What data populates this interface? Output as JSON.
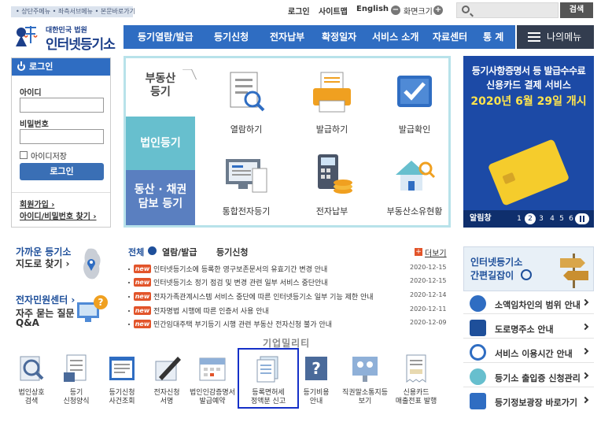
{
  "skip_links": "• 상단주메뉴 • 좌측서브메뉴 • 본문바로가기",
  "top_links": {
    "login": "로그인",
    "sitemap": "사이트맵",
    "english": "English",
    "zoom_label": "화면크기",
    "zoom_minus": "−",
    "zoom_plus": "+"
  },
  "search": {
    "placeholder": "",
    "button": "검색"
  },
  "logo": {
    "small": "대한민국 법원",
    "big": "인터넷등기소"
  },
  "gnb": [
    "등기열람/발급",
    "등기신청",
    "전자납부",
    "확정일자",
    "서비스 소개",
    "자료센터",
    "통 계"
  ],
  "my_menu": "나의메뉴",
  "login_box": {
    "title": "로그인",
    "id_label": "아이디",
    "pw_label": "비밀번호",
    "save_id": "아이디저장",
    "button": "로그인",
    "join": "회원가입 ›",
    "find": "아이디/비밀번호 찾기 ›"
  },
  "panel": {
    "cat1": "부동산\n등기",
    "cat2": "법인등기",
    "cat3": "동산 · 채권\n담보 등기",
    "items": [
      "열람하기",
      "발급하기",
      "발급확인",
      "통합전자등기",
      "전자납부",
      "부동산소유현황"
    ]
  },
  "banner": {
    "line1": "등기사항증명서 등 발급수수료",
    "line2": "신용카드 결제 서비스",
    "line3": "2020년 6월 29일 개시",
    "popup_label": "알림창",
    "pages": [
      "1",
      "2",
      "3",
      "4",
      "5",
      "6"
    ],
    "active_page": "2"
  },
  "quick_left": {
    "office_title": "가까운 등기소",
    "office_sub": "지도로 찾기 ›",
    "center_title": "전자민원센터 ›",
    "center_sub1": "자주 묻는 질문",
    "center_sub2": "Q&A"
  },
  "notice_tabs": {
    "all": "전체",
    "view": "열람/발급",
    "apply": "등기신청",
    "more": "더보기"
  },
  "notices": [
    {
      "badge": "new",
      "text": "인터넷등기소에 등록한 영구보존문서의 유효기간 변경 안내",
      "date": "2020-12-15"
    },
    {
      "badge": "new",
      "text": "인터넷등기소 정기 점검 및 변경 관련 일부 서비스 중단안내",
      "date": "2020-12-15"
    },
    {
      "badge": "new",
      "text": "전자가족관계시스템 서비스 중단에 따른 인터넷등기소 일부 기능 제한 안내",
      "date": "2020-12-14"
    },
    {
      "badge": "new",
      "text": "전자명법 시행에 따른 인증서 사용 안내",
      "date": "2020-12-11"
    },
    {
      "badge": "new",
      "text": "민간임대주택 부기등기 시행 관련 부동산 전자신청 불가 안내",
      "date": "2020-12-09"
    }
  ],
  "right_banner": {
    "line1": "인터넷등기소",
    "line2": "간편길잡이"
  },
  "right_list": [
    "소액임차인의 범위 안내",
    "도로명주소 안내",
    "서비스 이용시간 안내",
    "등기소 출입증 신청관리",
    "등기정보광장 바로가기"
  ],
  "bottom_icons": [
    {
      "label1": "법인상호",
      "label2": "검색"
    },
    {
      "label1": "등기",
      "label2": "신청양식"
    },
    {
      "label1": "등기신청",
      "label2": "사건조회"
    },
    {
      "label1": "전자신청",
      "label2": "서명"
    },
    {
      "label1": "법인인감증명서",
      "label2": "발급예약"
    },
    {
      "label1": "등록면허세",
      "label2": "정액분 신고"
    },
    {
      "label1": "등기비용",
      "label2": "안내"
    },
    {
      "label1": "직권말소통지등",
      "label2": "보기"
    },
    {
      "label1": "신용카드",
      "label2": "매출전표 발행"
    }
  ],
  "overlay_text": "기업밀리티",
  "colors": {
    "brand_blue": "#2f6dc2",
    "panel_border": "#b8e2ea",
    "badge_red": "#e2542a",
    "highlight": "#1530c8"
  }
}
